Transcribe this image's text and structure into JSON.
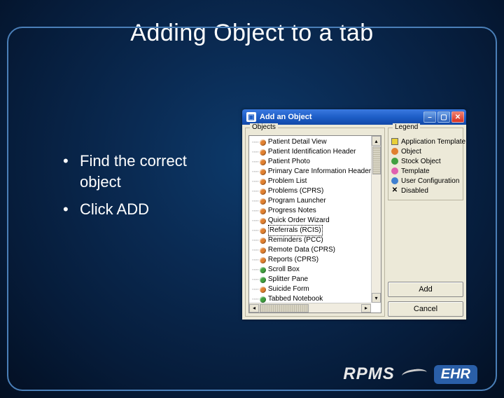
{
  "slide": {
    "title": "Adding Object to a tab",
    "bullets": [
      "Find the correct object",
      "Click ADD"
    ]
  },
  "dialog": {
    "title": "Add an Object",
    "objects_label": "Objects",
    "legend_label": "Legend",
    "items": [
      {
        "label": "Patient Detail View",
        "color": "orange"
      },
      {
        "label": "Patient Identification Header",
        "color": "orange"
      },
      {
        "label": "Patient Photo",
        "color": "orange"
      },
      {
        "label": "Primary Care Information Header",
        "color": "orange"
      },
      {
        "label": "Problem List",
        "color": "orange"
      },
      {
        "label": "Problems (CPRS)",
        "color": "orange"
      },
      {
        "label": "Program Launcher",
        "color": "orange"
      },
      {
        "label": "Progress Notes",
        "color": "orange"
      },
      {
        "label": "Quick Order Wizard",
        "color": "orange"
      },
      {
        "label": "Referrals (RCIS)",
        "color": "orange",
        "selected": true
      },
      {
        "label": "Reminders (PCC)",
        "color": "orange"
      },
      {
        "label": "Remote Data (CPRS)",
        "color": "orange"
      },
      {
        "label": "Reports (CPRS)",
        "color": "orange"
      },
      {
        "label": "Scroll Box",
        "color": "green"
      },
      {
        "label": "Splitter Pane",
        "color": "green"
      },
      {
        "label": "Suicide Form",
        "color": "orange"
      },
      {
        "label": "Tabbed Notebook",
        "color": "green"
      }
    ],
    "legend": [
      {
        "label": "Application Template",
        "kind": "box",
        "color": "yellow"
      },
      {
        "label": "Object",
        "kind": "circle",
        "color": "orange"
      },
      {
        "label": "Stock Object",
        "kind": "circle",
        "color": "green"
      },
      {
        "label": "Template",
        "kind": "circle",
        "color": "pink"
      },
      {
        "label": "User Configuration",
        "kind": "circle",
        "color": "blue"
      },
      {
        "label": "Disabled",
        "kind": "x",
        "color": "black"
      }
    ],
    "buttons": {
      "add": "Add",
      "cancel": "Cancel"
    }
  },
  "branding": {
    "rpms": "RPMS",
    "ehr": "EHR"
  }
}
